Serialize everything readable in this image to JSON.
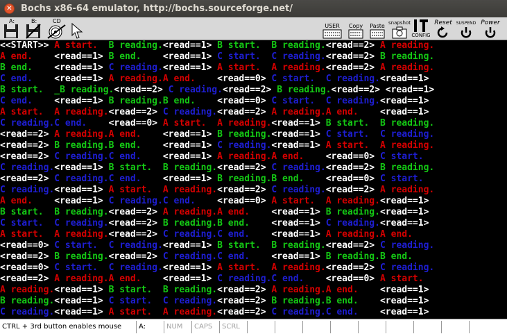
{
  "window": {
    "title": "Bochs x86-64 emulator, http://bochs.sourceforge.net/"
  },
  "toolbar": {
    "floppy_a": "A:",
    "floppy_b": "B:",
    "cdrom": "CD",
    "user": "USER",
    "copy": "Copy",
    "paste": "Paste",
    "snapshot": "snapshot",
    "config": "CONFIG",
    "reset": "Reset",
    "suspend": "SUSPEND",
    "power": "Power"
  },
  "screen": {
    "rows": [
      [
        {
          "t": "<<START>> ",
          "c": "w"
        },
        {
          "t": "A start.  ",
          "c": "r"
        },
        {
          "t": "B reading.",
          "c": "g"
        },
        {
          "t": "<read==1> ",
          "c": "w"
        },
        {
          "t": "B start.  ",
          "c": "g"
        },
        {
          "t": "B reading.",
          "c": "g"
        },
        {
          "t": "<read==2> ",
          "c": "w"
        },
        {
          "t": "A reading.",
          "c": "r"
        }
      ],
      [
        {
          "t": "A end.    ",
          "c": "r"
        },
        {
          "t": "<read==1> ",
          "c": "w"
        },
        {
          "t": "B end.    ",
          "c": "g"
        },
        {
          "t": "<read==1> ",
          "c": "w"
        },
        {
          "t": "C start.  ",
          "c": "b"
        },
        {
          "t": "C reading.",
          "c": "b"
        },
        {
          "t": "<read==2> ",
          "c": "w"
        },
        {
          "t": "B reading.",
          "c": "g"
        }
      ],
      [
        {
          "t": "B end.    ",
          "c": "g"
        },
        {
          "t": "<read==1> ",
          "c": "w"
        },
        {
          "t": "C reading.",
          "c": "b"
        },
        {
          "t": "<read==1> ",
          "c": "w"
        },
        {
          "t": "A start.  ",
          "c": "r"
        },
        {
          "t": "A reading.",
          "c": "r"
        },
        {
          "t": "<read==2> ",
          "c": "w"
        },
        {
          "t": "A reading.",
          "c": "r"
        }
      ],
      [
        {
          "t": "C end.    ",
          "c": "b"
        },
        {
          "t": "<read==1> ",
          "c": "w"
        },
        {
          "t": "A reading.",
          "c": "r"
        },
        {
          "t": "A end.    ",
          "c": "r"
        },
        {
          "t": "<read==0> ",
          "c": "w"
        },
        {
          "t": "C start.  ",
          "c": "b"
        },
        {
          "t": "C reading.",
          "c": "b"
        },
        {
          "t": "<read==1> ",
          "c": "w"
        }
      ],
      [
        {
          "t": "B start.  ",
          "c": "g"
        },
        {
          "t": "_B reading.",
          "c": "g"
        },
        {
          "t": "<read==2> ",
          "c": "w"
        },
        {
          "t": "C reading.",
          "c": "b"
        },
        {
          "t": "<read==2> ",
          "c": "w"
        },
        {
          "t": "B reading.",
          "c": "g"
        },
        {
          "t": "<read==2> ",
          "c": "w"
        },
        {
          "t": "<read==1> ",
          "c": "w"
        }
      ],
      [
        {
          "t": "C end.    ",
          "c": "b"
        },
        {
          "t": "<read==1> ",
          "c": "w"
        },
        {
          "t": "B reading.",
          "c": "g"
        },
        {
          "t": "B end.    ",
          "c": "g"
        },
        {
          "t": "<read==0> ",
          "c": "w"
        },
        {
          "t": "C start.  ",
          "c": "b"
        },
        {
          "t": "C reading.",
          "c": "b"
        },
        {
          "t": "<read==1> ",
          "c": "w"
        }
      ],
      [
        {
          "t": "A start.  ",
          "c": "r"
        },
        {
          "t": "A reading.",
          "c": "r"
        },
        {
          "t": "<read==2> ",
          "c": "w"
        },
        {
          "t": "C reading.",
          "c": "b"
        },
        {
          "t": "<read==2> ",
          "c": "w"
        },
        {
          "t": "A reading.",
          "c": "r"
        },
        {
          "t": "A end.    ",
          "c": "r"
        },
        {
          "t": "<read==1> ",
          "c": "w"
        }
      ],
      [
        {
          "t": "C reading.",
          "c": "b"
        },
        {
          "t": "C end.    ",
          "c": "b"
        },
        {
          "t": "<read==0> ",
          "c": "w"
        },
        {
          "t": "A start.  ",
          "c": "r"
        },
        {
          "t": "A reading.",
          "c": "r"
        },
        {
          "t": "<read==1> ",
          "c": "w"
        },
        {
          "t": "B start.  ",
          "c": "g"
        },
        {
          "t": "B reading.",
          "c": "g"
        }
      ],
      [
        {
          "t": "<read==2> ",
          "c": "w"
        },
        {
          "t": "A reading.",
          "c": "r"
        },
        {
          "t": "A end.    ",
          "c": "r"
        },
        {
          "t": "<read==1> ",
          "c": "w"
        },
        {
          "t": "B reading.",
          "c": "g"
        },
        {
          "t": "<read==1> ",
          "c": "w"
        },
        {
          "t": "C start.  ",
          "c": "b"
        },
        {
          "t": "C reading.",
          "c": "b"
        }
      ],
      [
        {
          "t": "<read==2> ",
          "c": "w"
        },
        {
          "t": "B reading.",
          "c": "g"
        },
        {
          "t": "B end.    ",
          "c": "g"
        },
        {
          "t": "<read==1> ",
          "c": "w"
        },
        {
          "t": "C reading.",
          "c": "b"
        },
        {
          "t": "<read==1> ",
          "c": "w"
        },
        {
          "t": "A start.  ",
          "c": "r"
        },
        {
          "t": "A reading.",
          "c": "r"
        }
      ],
      [
        {
          "t": "<read==2> ",
          "c": "w"
        },
        {
          "t": "C reading.",
          "c": "b"
        },
        {
          "t": "C end.    ",
          "c": "b"
        },
        {
          "t": "<read==1> ",
          "c": "w"
        },
        {
          "t": "A reading.",
          "c": "r"
        },
        {
          "t": "A end.    ",
          "c": "r"
        },
        {
          "t": "<read==0> ",
          "c": "w"
        },
        {
          "t": "C start.  ",
          "c": "b"
        }
      ],
      [
        {
          "t": "C reading.",
          "c": "b"
        },
        {
          "t": "<read==1> ",
          "c": "w"
        },
        {
          "t": "B start.  ",
          "c": "g"
        },
        {
          "t": "B reading.",
          "c": "g"
        },
        {
          "t": "<read==2> ",
          "c": "w"
        },
        {
          "t": "C reading.",
          "c": "b"
        },
        {
          "t": "<read==2> ",
          "c": "w"
        },
        {
          "t": "B reading.",
          "c": "g"
        }
      ],
      [
        {
          "t": "<read==2> ",
          "c": "w"
        },
        {
          "t": "C reading.",
          "c": "b"
        },
        {
          "t": "C end.    ",
          "c": "b"
        },
        {
          "t": "<read==1> ",
          "c": "w"
        },
        {
          "t": "B reading.",
          "c": "g"
        },
        {
          "t": "B end.    ",
          "c": "g"
        },
        {
          "t": "<read==0> ",
          "c": "w"
        },
        {
          "t": "C start.  ",
          "c": "b"
        }
      ],
      [
        {
          "t": "C reading.",
          "c": "b"
        },
        {
          "t": "<read==1> ",
          "c": "w"
        },
        {
          "t": "A start.  ",
          "c": "r"
        },
        {
          "t": "A reading.",
          "c": "r"
        },
        {
          "t": "<read==2> ",
          "c": "w"
        },
        {
          "t": "C reading.",
          "c": "b"
        },
        {
          "t": "<read==2> ",
          "c": "w"
        },
        {
          "t": "A reading.",
          "c": "r"
        }
      ],
      [
        {
          "t": "A end.    ",
          "c": "r"
        },
        {
          "t": "<read==1> ",
          "c": "w"
        },
        {
          "t": "C reading.",
          "c": "b"
        },
        {
          "t": "C end.    ",
          "c": "b"
        },
        {
          "t": "<read==0> ",
          "c": "w"
        },
        {
          "t": "A start.  ",
          "c": "r"
        },
        {
          "t": "A reading.",
          "c": "r"
        },
        {
          "t": "<read==1> ",
          "c": "w"
        }
      ],
      [
        {
          "t": "B start.  ",
          "c": "g"
        },
        {
          "t": "B reading.",
          "c": "g"
        },
        {
          "t": "<read==2> ",
          "c": "w"
        },
        {
          "t": "A reading.",
          "c": "r"
        },
        {
          "t": "A end.    ",
          "c": "r"
        },
        {
          "t": "<read==1> ",
          "c": "w"
        },
        {
          "t": "B reading.",
          "c": "g"
        },
        {
          "t": "<read==1> ",
          "c": "w"
        }
      ],
      [
        {
          "t": "C start.  ",
          "c": "b"
        },
        {
          "t": "C reading.",
          "c": "b"
        },
        {
          "t": "<read==2> ",
          "c": "w"
        },
        {
          "t": "B reading.",
          "c": "g"
        },
        {
          "t": "B end.    ",
          "c": "g"
        },
        {
          "t": "<read==1> ",
          "c": "w"
        },
        {
          "t": "C reading.",
          "c": "b"
        },
        {
          "t": "<read==1> ",
          "c": "w"
        }
      ],
      [
        {
          "t": "A start.  ",
          "c": "r"
        },
        {
          "t": "A reading.",
          "c": "r"
        },
        {
          "t": "<read==2> ",
          "c": "w"
        },
        {
          "t": "C reading.",
          "c": "b"
        },
        {
          "t": "C end.    ",
          "c": "b"
        },
        {
          "t": "<read==1> ",
          "c": "w"
        },
        {
          "t": "A reading.",
          "c": "r"
        },
        {
          "t": "A end.    ",
          "c": "r"
        }
      ],
      [
        {
          "t": "<read==0> ",
          "c": "w"
        },
        {
          "t": "C start.  ",
          "c": "b"
        },
        {
          "t": "C reading.",
          "c": "b"
        },
        {
          "t": "<read==1> ",
          "c": "w"
        },
        {
          "t": "B start.  ",
          "c": "g"
        },
        {
          "t": "B reading.",
          "c": "g"
        },
        {
          "t": "<read==2> ",
          "c": "w"
        },
        {
          "t": "C reading.",
          "c": "b"
        }
      ],
      [
        {
          "t": "<read==2> ",
          "c": "w"
        },
        {
          "t": "B reading.",
          "c": "g"
        },
        {
          "t": "<read==2> ",
          "c": "w"
        },
        {
          "t": "C reading.",
          "c": "b"
        },
        {
          "t": "C end.    ",
          "c": "b"
        },
        {
          "t": "<read==1> ",
          "c": "w"
        },
        {
          "t": "B reading.",
          "c": "g"
        },
        {
          "t": "B end.    ",
          "c": "g"
        }
      ],
      [
        {
          "t": "<read==0> ",
          "c": "w"
        },
        {
          "t": "C start.  ",
          "c": "b"
        },
        {
          "t": "C reading.",
          "c": "b"
        },
        {
          "t": "<read==1> ",
          "c": "w"
        },
        {
          "t": "A start.  ",
          "c": "r"
        },
        {
          "t": "A reading.",
          "c": "r"
        },
        {
          "t": "<read==2> ",
          "c": "w"
        },
        {
          "t": "C reading.",
          "c": "b"
        }
      ],
      [
        {
          "t": "<read==2> ",
          "c": "w"
        },
        {
          "t": "A reading.",
          "c": "r"
        },
        {
          "t": "A end.    ",
          "c": "r"
        },
        {
          "t": "<read==1> ",
          "c": "w"
        },
        {
          "t": "C reading.",
          "c": "b"
        },
        {
          "t": "C end.    ",
          "c": "b"
        },
        {
          "t": "<read==0> ",
          "c": "w"
        },
        {
          "t": "A start.  ",
          "c": "r"
        }
      ],
      [
        {
          "t": "A reading.",
          "c": "r"
        },
        {
          "t": "<read==1> ",
          "c": "w"
        },
        {
          "t": "B start.  ",
          "c": "g"
        },
        {
          "t": "B reading.",
          "c": "g"
        },
        {
          "t": "<read==2> ",
          "c": "w"
        },
        {
          "t": "A reading.",
          "c": "r"
        },
        {
          "t": "A end.    ",
          "c": "r"
        },
        {
          "t": "<read==1> ",
          "c": "w"
        }
      ],
      [
        {
          "t": "B reading.",
          "c": "g"
        },
        {
          "t": "<read==1> ",
          "c": "w"
        },
        {
          "t": "C start.  ",
          "c": "b"
        },
        {
          "t": "C reading.",
          "c": "b"
        },
        {
          "t": "<read==2> ",
          "c": "w"
        },
        {
          "t": "B reading.",
          "c": "g"
        },
        {
          "t": "B end.    ",
          "c": "g"
        },
        {
          "t": "<read==1> ",
          "c": "w"
        }
      ],
      [
        {
          "t": "C reading.",
          "c": "b"
        },
        {
          "t": "<read==1> ",
          "c": "w"
        },
        {
          "t": "A start.  ",
          "c": "r"
        },
        {
          "t": "A reading.",
          "c": "r"
        },
        {
          "t": "<read==2> ",
          "c": "w"
        },
        {
          "t": "C reading.",
          "c": "b"
        },
        {
          "t": "C end.    ",
          "c": "b"
        },
        {
          "t": "<read==1> ",
          "c": "w"
        }
      ]
    ]
  },
  "statusbar": {
    "mouse_hint": "CTRL + 3rd button enables mouse",
    "drive": "A:",
    "num": "NUM",
    "caps": "CAPS",
    "scrl": "SCRL"
  },
  "colors": {
    "w": "#ffffff",
    "r": "#d40000",
    "g": "#14c814",
    "b": "#1e1ed2"
  }
}
